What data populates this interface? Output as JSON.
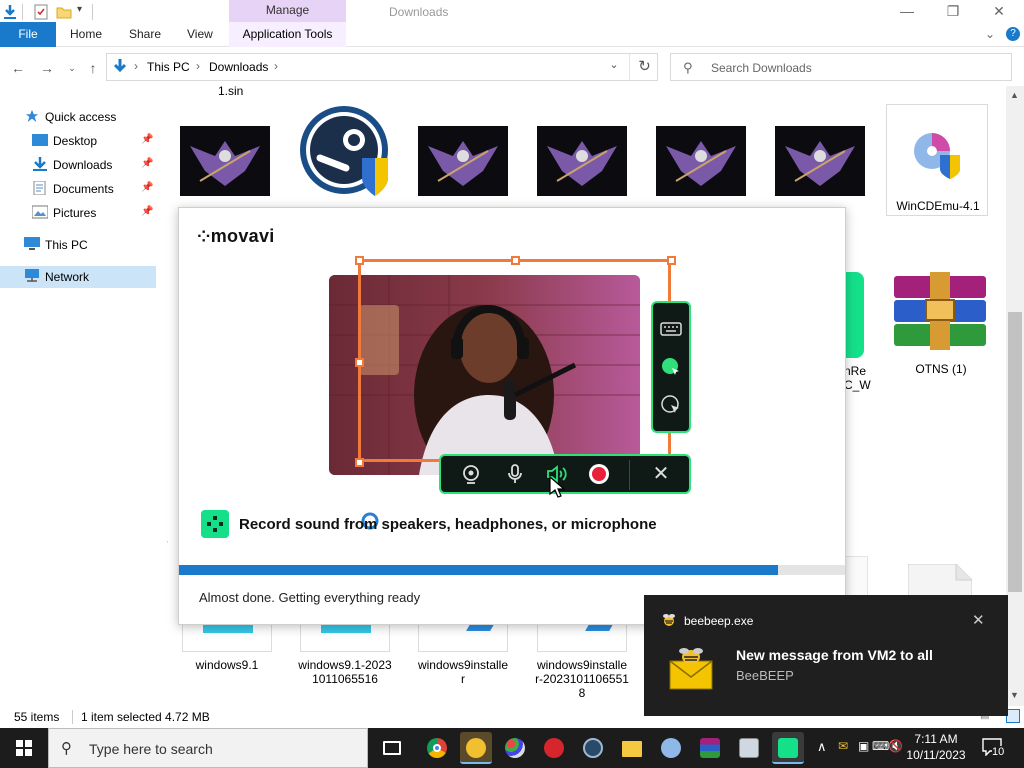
{
  "window": {
    "title": "Downloads",
    "contextual_tab": "Manage",
    "controls": {
      "minimize": "—",
      "maximize": "❐",
      "close": "✕"
    }
  },
  "ribbon": {
    "tabs": [
      "File",
      "Home",
      "Share",
      "View",
      "Application Tools"
    ],
    "expand": "⌄",
    "help": "?"
  },
  "address": {
    "crumbs": [
      "This PC",
      "Downloads"
    ],
    "search_placeholder": "Search Downloads"
  },
  "nav": {
    "items": [
      {
        "label": "Quick access",
        "icon": "star-icon"
      },
      {
        "label": "Desktop",
        "icon": "desktop-icon",
        "pinned": true
      },
      {
        "label": "Downloads",
        "icon": "download-icon",
        "pinned": true
      },
      {
        "label": "Documents",
        "icon": "documents-icon",
        "pinned": true
      },
      {
        "label": "Pictures",
        "icon": "pictures-icon",
        "pinned": true
      },
      {
        "label": "This PC",
        "icon": "computer-icon"
      },
      {
        "label": "Network",
        "icon": "network-icon",
        "selected": true
      }
    ]
  },
  "files": {
    "top_partial": "1.sin",
    "row1": [
      {
        "name": "",
        "thumb": "dragon"
      },
      {
        "name": "",
        "thumb": "steam"
      },
      {
        "name": "",
        "thumb": "dragon"
      },
      {
        "name": "",
        "thumb": "dragon"
      },
      {
        "name": "",
        "thumb": "dragon"
      },
      {
        "name": "",
        "thumb": "dragon"
      },
      {
        "name": "WinCDEmu-4.1",
        "thumb": "wincdemu"
      }
    ],
    "right_col": [
      {
        "name": "OTNS (1)",
        "thumb": "winrar"
      }
    ],
    "bottom_row": [
      "windows9.1",
      "windows9.1-2023\n1011065516",
      "windows9installe\nr",
      "windows9installe\nr-2023101106551\n8"
    ]
  },
  "status": {
    "items": "55 items",
    "selected": "1 item selected  4.72 MB"
  },
  "installer": {
    "brand": "movavi",
    "feature": "Record sound from speakers, headphones, or microphone",
    "status_message": "Almost done. Getting everything ready",
    "progress": 0.9
  },
  "toast": {
    "app": "beebeep.exe",
    "title": "New message from VM2 to all",
    "subtitle": "BeeBEEP"
  },
  "taskbar": {
    "search_placeholder": "Type here to search",
    "time": "7:11 AM",
    "date": "10/11/2023",
    "notification_count": "10"
  },
  "colors": {
    "accent": "#1979ca",
    "manage_tab": "#e6d3f5",
    "movavi_green": "#2ee079",
    "selection_orange": "#f07a3a",
    "toast_bg": "#1f1f1f",
    "taskbar_bg": "#1c1c1c"
  }
}
